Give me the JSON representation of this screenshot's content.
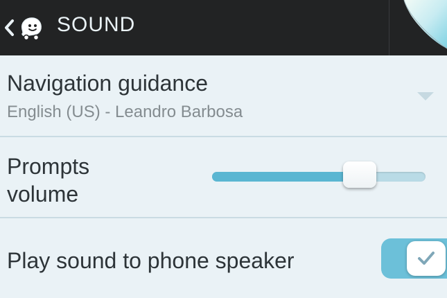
{
  "header": {
    "title": "SOUND",
    "icons": {
      "back": "chevron-left-icon",
      "logo": "waze-logo-icon"
    }
  },
  "settings": {
    "navigation_guidance": {
      "label": "Navigation guidance",
      "value": "English (US) - Leandro Barbosa"
    },
    "prompts_volume": {
      "label": "Prompts volume",
      "level": 0.69
    },
    "play_sound_speaker": {
      "label": "Play sound to phone speaker",
      "checked": true
    }
  },
  "colors": {
    "header_bg": "#222324",
    "page_bg": "#eaf2f6",
    "accent": "#5ab6d2",
    "text": "#2d3438",
    "subtext": "#848c90"
  }
}
